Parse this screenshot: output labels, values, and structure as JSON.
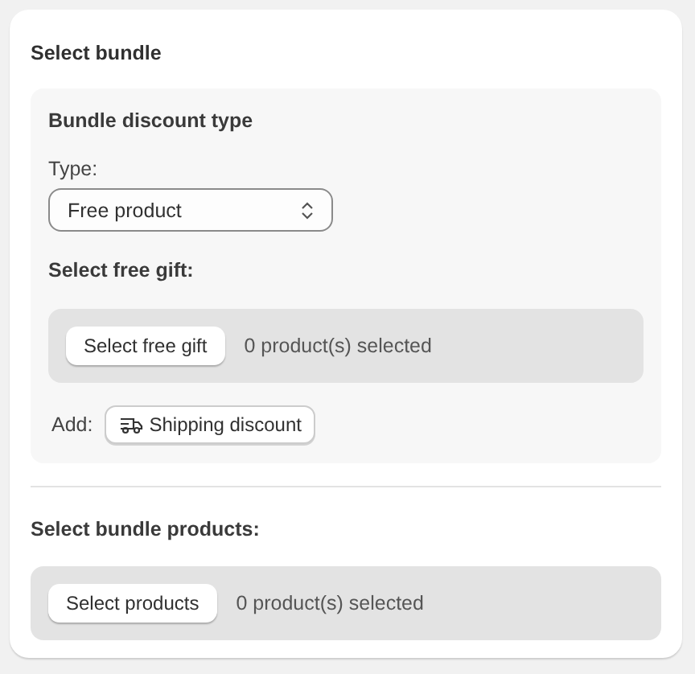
{
  "card": {
    "title": "Select bundle"
  },
  "discount": {
    "heading": "Bundle discount type",
    "type_label": "Type:",
    "type_value": "Free product",
    "gift_label": "Select free gift:",
    "gift_button": "Select free gift",
    "gift_count": "0 product(s) selected",
    "add_label": "Add:",
    "add_button": "Shipping discount"
  },
  "products": {
    "label": "Select bundle products:",
    "button": "Select products",
    "count": "0 product(s) selected"
  }
}
